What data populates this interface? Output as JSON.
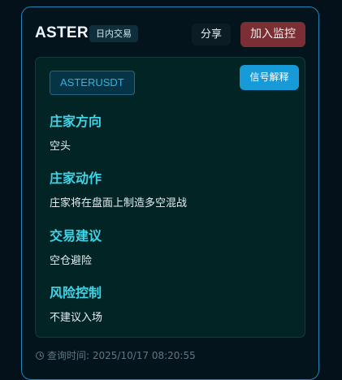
{
  "header": {
    "asset": "ASTER",
    "mode_tag": "日内交易",
    "share_label": "分享",
    "monitor_label": "加入监控"
  },
  "signal": {
    "symbol": "ASTERUSDT",
    "explain_label": "信号解释",
    "sections": [
      {
        "title": "庄家方向",
        "value": "空头"
      },
      {
        "title": "庄家动作",
        "value": "庄家将在盘面上制造多空混战"
      },
      {
        "title": "交易建议",
        "value": "空仓避险"
      },
      {
        "title": "风险控制",
        "value": "不建议入场"
      }
    ]
  },
  "footer": {
    "query_time": "查询时间: 2025/10/17 08:20:55"
  },
  "colors": {
    "accent": "#3fd4e6",
    "monitor_button": "#7b2e33",
    "explain_button": "#169ad8",
    "card_border": "#1f86b5"
  },
  "icons": {
    "footer_icon": "clock-icon"
  }
}
